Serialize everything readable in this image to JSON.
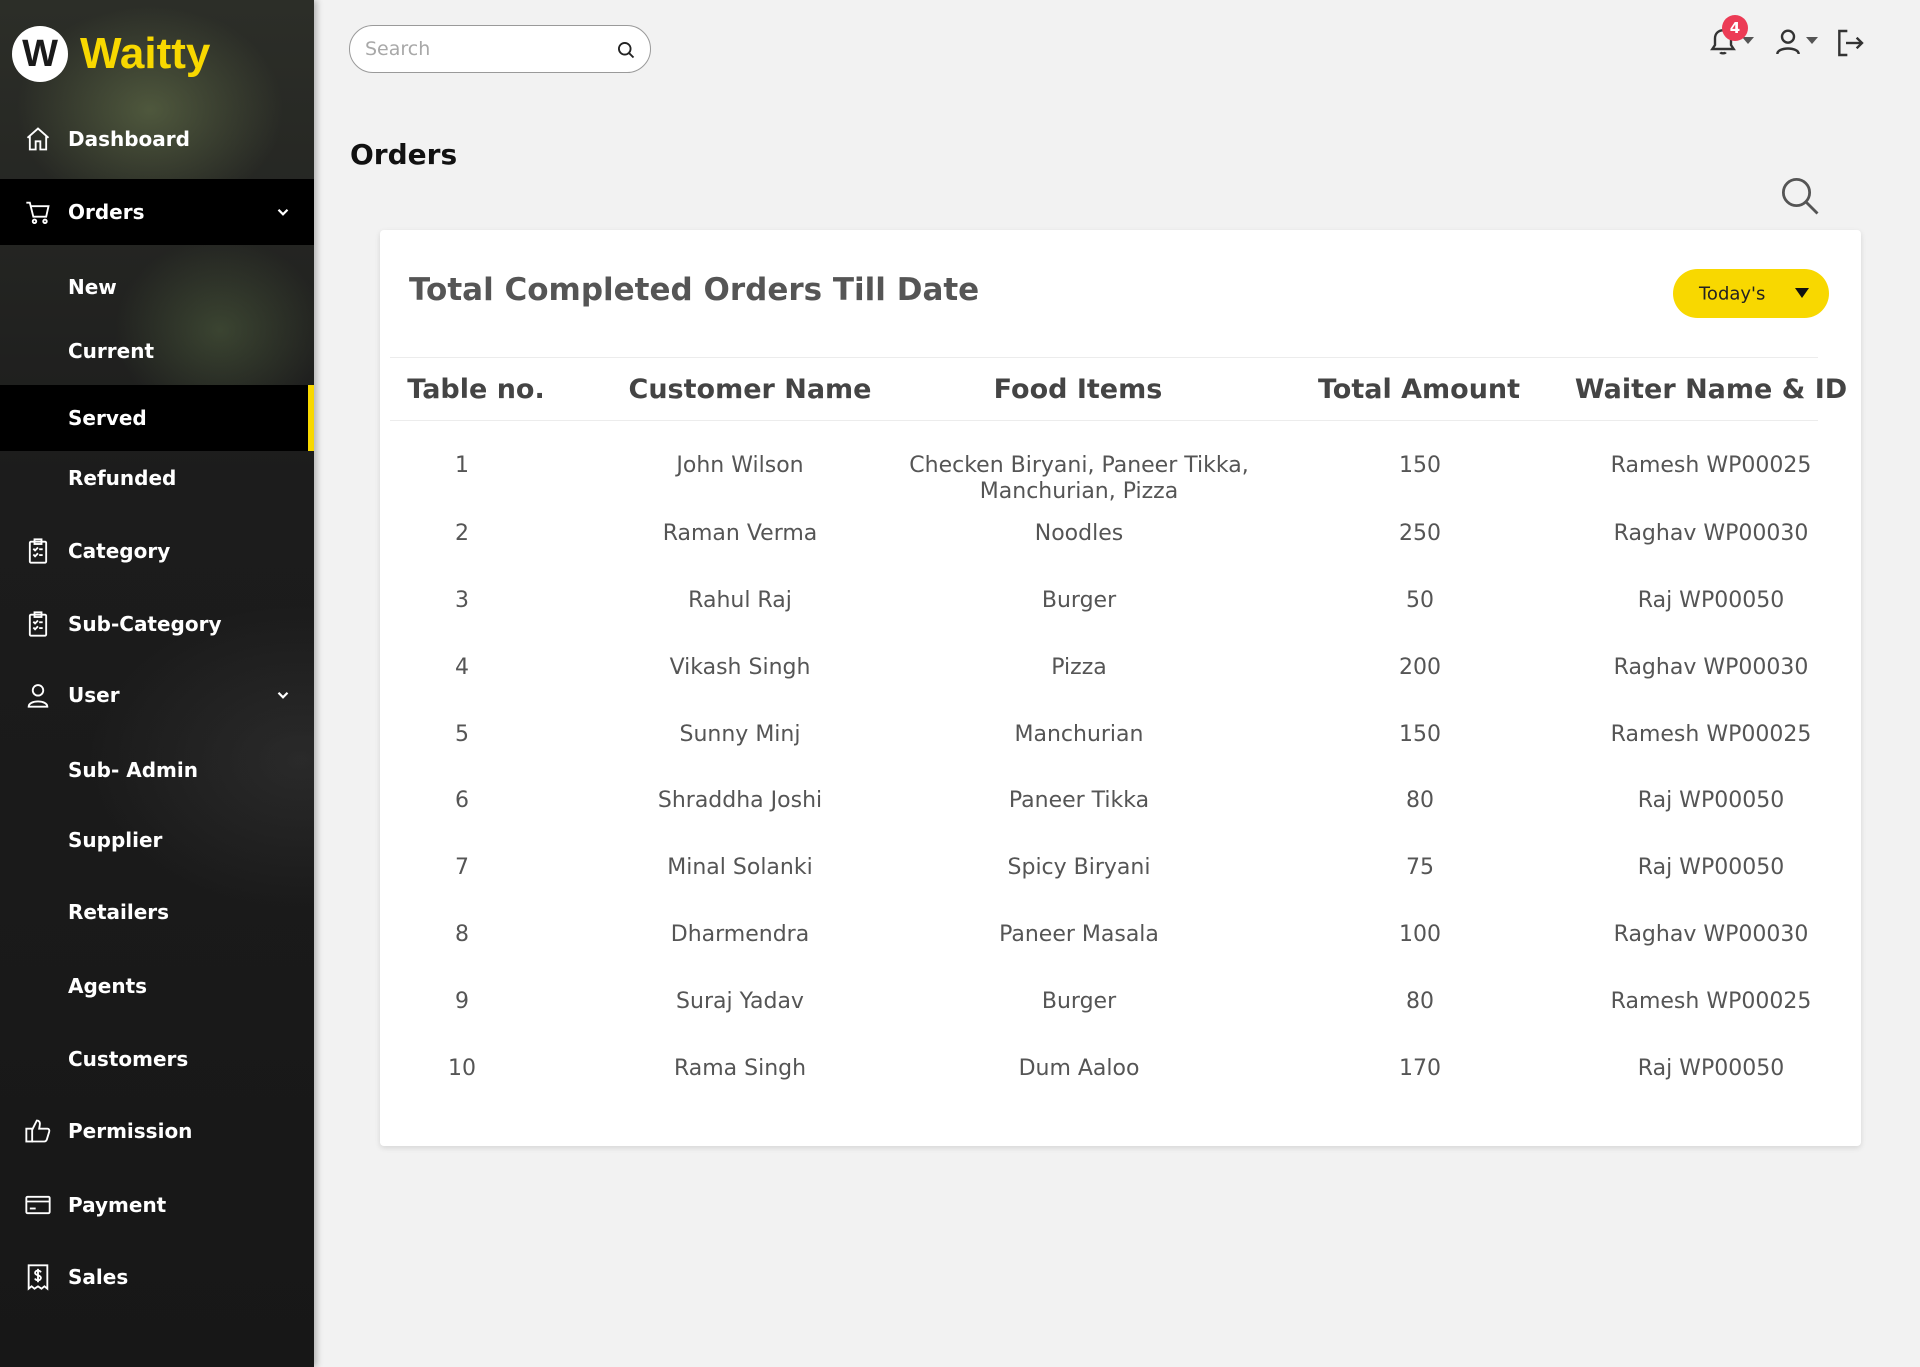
{
  "brand": {
    "logo_letter": "W",
    "name": "Waitty",
    "color": "#f8d800"
  },
  "sidebar": {
    "items": [
      {
        "label": "Dashboard",
        "icon": "home-icon"
      },
      {
        "label": "Orders",
        "icon": "cart-icon",
        "expanded": true
      },
      {
        "label": "New"
      },
      {
        "label": "Current"
      },
      {
        "label": "Served",
        "active": true
      },
      {
        "label": "Refunded"
      },
      {
        "label": "Category",
        "icon": "clipboard-icon"
      },
      {
        "label": "Sub-Category",
        "icon": "clipboard-icon"
      },
      {
        "label": "User",
        "icon": "user-icon",
        "expanded": true
      },
      {
        "label": "Sub- Admin"
      },
      {
        "label": "Supplier"
      },
      {
        "label": "Retailers"
      },
      {
        "label": "Agents"
      },
      {
        "label": "Customers"
      },
      {
        "label": "Permission",
        "icon": "thumbs-up-icon"
      },
      {
        "label": "Payment",
        "icon": "credit-card-icon"
      },
      {
        "label": "Sales",
        "icon": "dollar-receipt-icon"
      }
    ]
  },
  "header": {
    "search_placeholder": "Search",
    "search_value": "",
    "notification_count": "4",
    "badge_color": "#ec3b55"
  },
  "page": {
    "title": "Orders"
  },
  "card": {
    "title": "Total Completed Orders Till Date",
    "period_label": "Today's",
    "columns": [
      "Table no.",
      "Customer Name",
      "Food Items",
      "Total Amount",
      "Waiter Name & ID"
    ],
    "rows": [
      [
        "1",
        "John Wilson",
        "Checken Biryani, Paneer Tikka, Manchurian, Pizza",
        "150",
        "Ramesh WP00025"
      ],
      [
        "2",
        "Raman Verma",
        "Noodles",
        "250",
        "Raghav WP00030"
      ],
      [
        "3",
        "Rahul Raj",
        "Burger",
        "50",
        "Raj WP00050"
      ],
      [
        "4",
        "Vikash Singh",
        "Pizza",
        "200",
        "Raghav WP00030"
      ],
      [
        "5",
        "Sunny Minj",
        "Manchurian",
        "150",
        "Ramesh WP00025"
      ],
      [
        "6",
        "Shraddha Joshi",
        "Paneer Tikka",
        "80",
        "Raj WP00050"
      ],
      [
        "7",
        "Minal Solanki",
        "Spicy Biryani",
        "75",
        "Raj WP00050"
      ],
      [
        "8",
        "Dharmendra",
        "Paneer Masala",
        "100",
        "Raghav WP00030"
      ],
      [
        "9",
        "Suraj Yadav",
        "Burger",
        "80",
        "Ramesh WP00025"
      ],
      [
        "10",
        "Rama Singh",
        "Dum Aaloo",
        "170",
        "Raj WP00050"
      ]
    ]
  }
}
